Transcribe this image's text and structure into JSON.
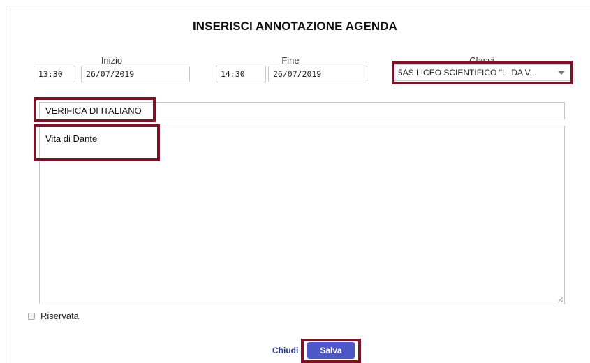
{
  "dialog": {
    "title": "INSERISCI ANNOTAZIONE AGENDA"
  },
  "start": {
    "label": "Inizio",
    "time": "13:30",
    "date": "26/07/2019"
  },
  "end": {
    "label": "Fine",
    "time": "14:30",
    "date": "26/07/2019"
  },
  "classes": {
    "label": "Classi",
    "selected": "5AS LICEO SCIENTIFICO \"L. DA V..."
  },
  "note": {
    "title": "VERIFICA DI ITALIANO",
    "text": "Vita di Dante"
  },
  "options": {
    "reserved_label": "Riservata",
    "reserved_checked": false
  },
  "actions": {
    "close_label": "Chiudi",
    "save_label": "Salva"
  },
  "colors": {
    "highlight": "#7a1228",
    "save_button": "#4d57c7",
    "close_link": "#2c3a8f"
  }
}
